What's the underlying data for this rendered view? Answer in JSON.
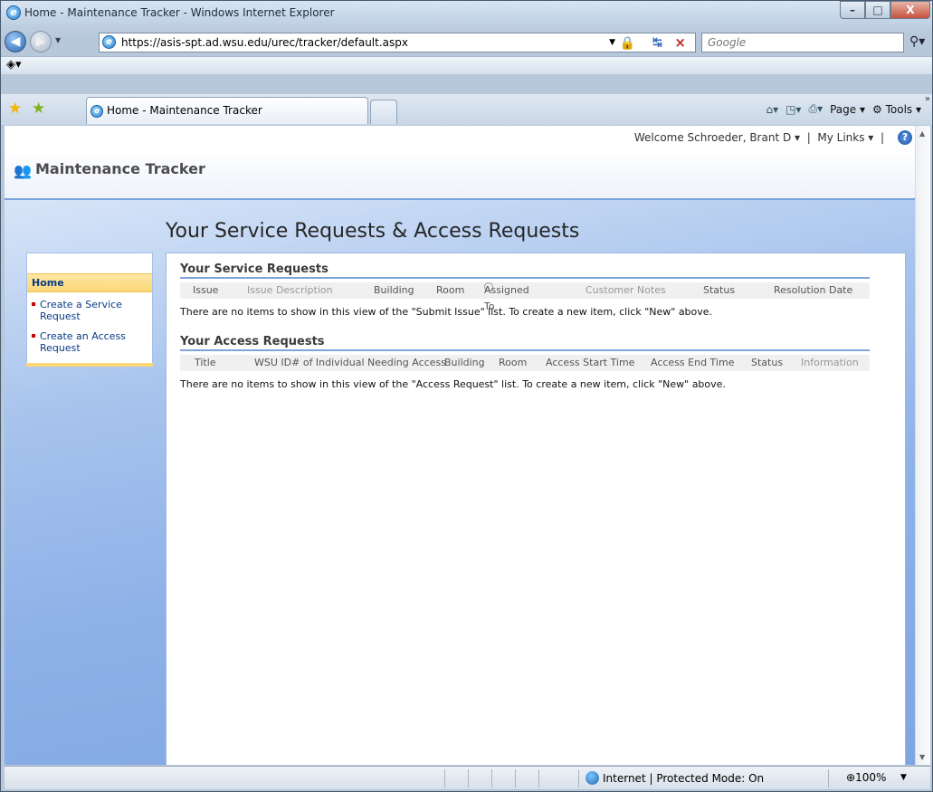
{
  "window": {
    "title": "Home - Maintenance Tracker - Windows Internet Explorer",
    "min": "–",
    "max": "□",
    "close": "X"
  },
  "address": {
    "url": "https://asis-spt.ad.wsu.edu/urec/tracker/default.aspx",
    "search_placeholder": "Google"
  },
  "tab": {
    "label": "Home - Maintenance Tracker"
  },
  "commandbar": {
    "page": "Page",
    "tools": "Tools"
  },
  "site": {
    "welcome": "Welcome Schroeder, Brant D",
    "mylinks": "My Links",
    "name": "Maintenance Tracker",
    "page_title": "Your Service Requests & Access Requests"
  },
  "quicklaunch": {
    "home": "Home",
    "items": [
      "Create a Service Request",
      "Create an Access Request"
    ]
  },
  "service": {
    "title": "Your Service Requests",
    "columns": [
      "Issue",
      "Issue Description",
      "Building",
      "Room",
      "Assigned To",
      "Customer Notes",
      "Status",
      "Resolution Date"
    ],
    "empty": "There are no items to show in this view of the \"Submit Issue\" list. To create a new item, click \"New\" above."
  },
  "access": {
    "title": "Your Access Requests",
    "columns": [
      "Title",
      "WSU ID# of Individual Needing Access",
      "Building",
      "Room",
      "Access Start Time",
      "Access End Time",
      "Status",
      "Information"
    ],
    "empty": "There are no items to show in this view of the \"Access Request\" list. To create a new item, click \"New\" above."
  },
  "statusbar": {
    "zone": "Internet | Protected Mode: On",
    "zoom": "100%"
  }
}
